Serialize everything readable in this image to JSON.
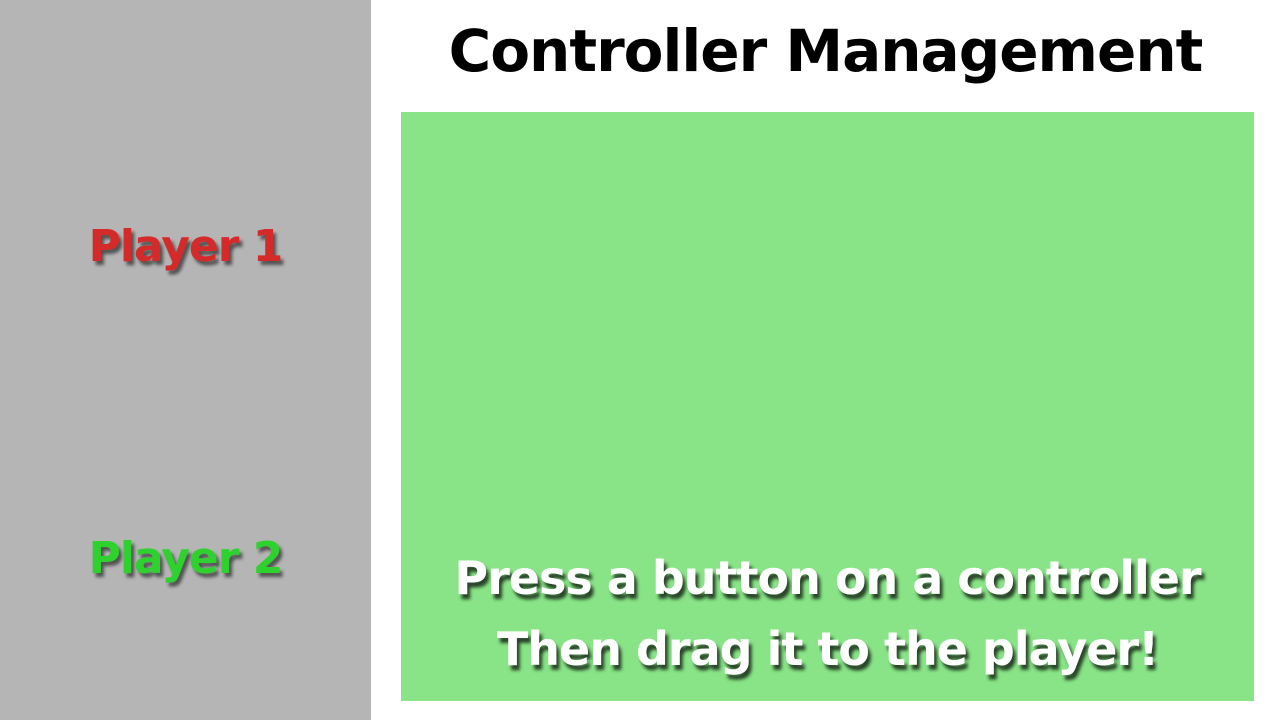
{
  "title": "Controller Management",
  "players": [
    {
      "label": "Player 1",
      "color": "#d42a2a"
    },
    {
      "label": "Player 2",
      "color": "#2fd12f"
    }
  ],
  "drop_zone": {
    "instruction_line1": "Press a button on a controller",
    "instruction_line2": "Then drag it to the player!",
    "background_color": "#88e486"
  },
  "sidebar_color": "#b5b5b5"
}
